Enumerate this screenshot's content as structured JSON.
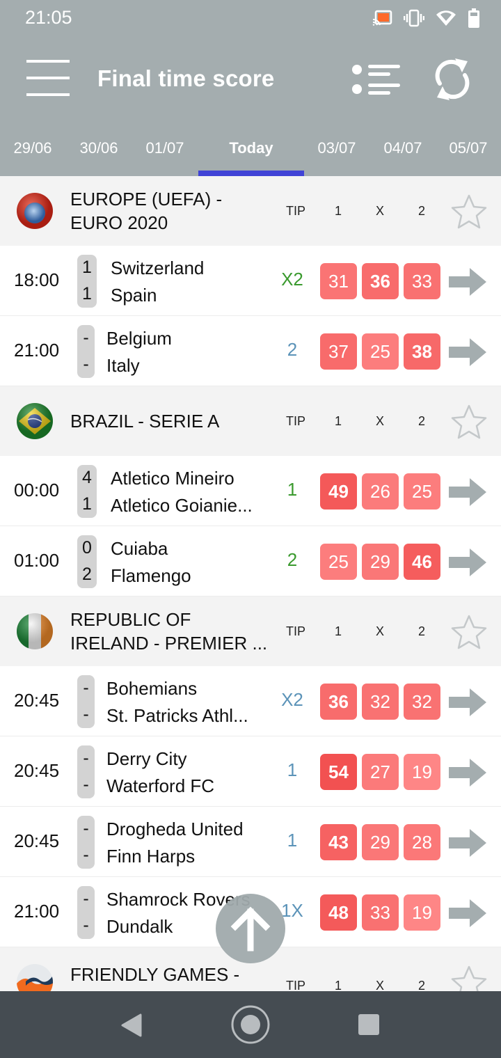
{
  "status_bar": {
    "time": "21:05",
    "icons": [
      "cast-icon",
      "vibrate-icon",
      "wifi-icon",
      "battery-icon"
    ]
  },
  "app_bar": {
    "title": "Final time score",
    "menu_icon": "hamburger-menu-icon",
    "actions": [
      "list-view-icon",
      "refresh-icon"
    ]
  },
  "date_tabs": [
    {
      "label": "29/06",
      "active": false
    },
    {
      "label": "30/06",
      "active": false
    },
    {
      "label": "01/07",
      "active": false
    },
    {
      "label": "Today",
      "active": true
    },
    {
      "label": "03/07",
      "active": false
    },
    {
      "label": "04/07",
      "active": false
    },
    {
      "label": "05/07",
      "active": false
    }
  ],
  "column_headers": {
    "tip": "TIP",
    "home": "1",
    "draw": "X",
    "away": "2"
  },
  "colors": {
    "header_bg": "#a4adaf",
    "tab_indicator": "#4043d6",
    "tip_correct": "#3a9a2e",
    "tip_pending": "#5b93b8",
    "prob_base": "#f04848",
    "arrow": "#a4adaf",
    "navbar_bg": "#454c52"
  },
  "leagues": [
    {
      "name": "EUROPE (UEFA) - EURO 2020",
      "logo": "uefa-logo",
      "matches": [
        {
          "time": "18:00",
          "home": "Switzerland",
          "away": "Spain",
          "home_score": "1",
          "away_score": "1",
          "tip": "X2",
          "tip_status": "correct",
          "p1": "31",
          "px": "36",
          "p2": "33",
          "best": "x"
        },
        {
          "time": "21:00",
          "home": "Belgium",
          "away": "Italy",
          "home_score": "-",
          "away_score": "-",
          "tip": "2",
          "tip_status": "pending",
          "p1": "37",
          "px": "25",
          "p2": "38",
          "best": "2"
        }
      ]
    },
    {
      "name": "BRAZIL - SERIE A",
      "logo": "brazil-flag",
      "matches": [
        {
          "time": "00:00",
          "home": "Atletico Mineiro",
          "away": "Atletico Goianie...",
          "home_score": "4",
          "away_score": "1",
          "tip": "1",
          "tip_status": "correct",
          "p1": "49",
          "px": "26",
          "p2": "25",
          "best": "1"
        },
        {
          "time": "01:00",
          "home": "Cuiaba",
          "away": "Flamengo",
          "home_score": "0",
          "away_score": "2",
          "tip": "2",
          "tip_status": "correct",
          "p1": "25",
          "px": "29",
          "p2": "46",
          "best": "2"
        }
      ]
    },
    {
      "name": "REPUBLIC OF IRELAND - PREMIER ...",
      "logo": "ireland-flag",
      "matches": [
        {
          "time": "20:45",
          "home": "Bohemians",
          "away": "St. Patricks Athl...",
          "home_score": "-",
          "away_score": "-",
          "tip": "X2",
          "tip_status": "pending",
          "p1": "36",
          "px": "32",
          "p2": "32",
          "best": "1"
        },
        {
          "time": "20:45",
          "home": "Derry City",
          "away": "Waterford FC",
          "home_score": "-",
          "away_score": "-",
          "tip": "1",
          "tip_status": "pending",
          "p1": "54",
          "px": "27",
          "p2": "19",
          "best": "1"
        },
        {
          "time": "20:45",
          "home": "Drogheda United",
          "away": "Finn Harps",
          "home_score": "-",
          "away_score": "-",
          "tip": "1",
          "tip_status": "pending",
          "p1": "43",
          "px": "29",
          "p2": "28",
          "best": "1"
        },
        {
          "time": "21:00",
          "home": "Shamrock Rovers",
          "away": "Dundalk",
          "home_score": "-",
          "away_score": "-",
          "tip": "1X",
          "tip_status": "pending",
          "p1": "48",
          "px": "33",
          "p2": "19",
          "best": "1"
        }
      ]
    },
    {
      "name": "FRIENDLY GAMES - CLUB FRIENDLIES",
      "logo": "friendly-games-logo",
      "matches": []
    }
  ],
  "scroll_top_button": "arrow-up-icon",
  "nav_bar": [
    "back-icon",
    "home-icon",
    "recents-icon"
  ]
}
